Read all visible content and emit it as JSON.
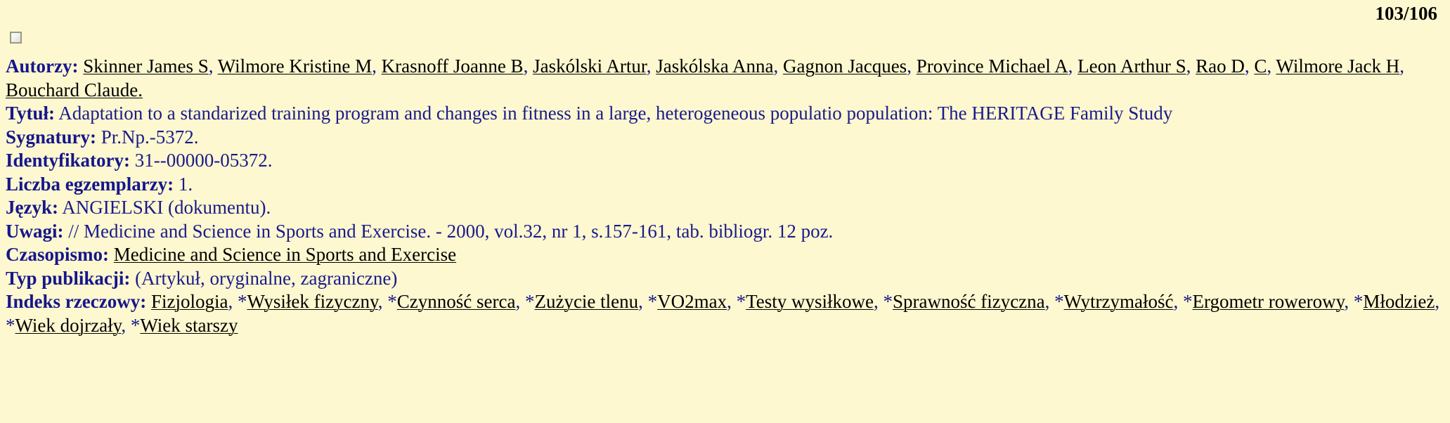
{
  "page": {
    "counter": "103/106",
    "background_color": "#fdf8cf",
    "label_color": "#16168c",
    "link_color": "#000000"
  },
  "controls": {
    "select_checkbox_name": "select-record-checkbox"
  },
  "record": {
    "fields": [
      {
        "key": "autorzy",
        "label": "Autorzy:"
      },
      {
        "key": "tytul",
        "label": "Tytuł:"
      },
      {
        "key": "sygnatury",
        "label": "Sygnatury:"
      },
      {
        "key": "identyfikatory",
        "label": "Identyfikatory:"
      },
      {
        "key": "liczba_egzemplarzy",
        "label": "Liczba egzemplarzy:"
      },
      {
        "key": "jezyk",
        "label": "Język:"
      },
      {
        "key": "uwagi",
        "label": "Uwagi:"
      },
      {
        "key": "czasopismo",
        "label": "Czasopismo:"
      },
      {
        "key": "typ_publikacji",
        "label": "Typ publikacji:"
      },
      {
        "key": "indeks_rzeczowy",
        "label": "Indeks rzeczowy:"
      }
    ],
    "labels": {
      "autorzy": "Autorzy:",
      "tytul": "Tytuł:",
      "sygnatury": "Sygnatury:",
      "identyfikatory": "Identyfikatory:",
      "liczba_egzemplarzy": "Liczba egzemplarzy:",
      "jezyk": "Język:",
      "uwagi": "Uwagi:",
      "czasopismo": "Czasopismo:",
      "typ_publikacji": "Typ publikacji:",
      "indeks_rzeczowy": "Indeks rzeczowy:"
    },
    "authors": [
      "Skinner James S",
      "Wilmore Kristine M",
      "Krasnoff Joanne B",
      "Jaskólski Artur",
      "Jaskólska Anna",
      "Gagnon Jacques",
      "Province Michael A",
      "Leon Arthur S",
      "Rao D",
      "C",
      "Wilmore Jack H",
      "Bouchard Claude."
    ],
    "title": "Adaptation to a standarized training program and changes in fitness in a large, heterogeneous populatio population: The HERITAGE Family Study",
    "sygnatury": "Pr.Np.-5372.",
    "identyfikatory": "31--00000-05372.",
    "liczba_egzemplarzy": "1.",
    "jezyk": "ANGIELSKI (dokumentu).",
    "uwagi": "// Medicine and Science in Sports and Exercise. - 2000, vol.32, nr 1, s.157-161, tab. bibliogr. 12 poz.",
    "czasopismo": "Medicine and Science in Sports and Exercise",
    "typ_publikacji": "(Artykuł, oryginalne, zagraniczne)",
    "indeks_rzeczowy": [
      "Fizjologia",
      "*Wysiłek fizyczny",
      "*Czynność serca",
      "*Zużycie tlenu",
      "*VO2max",
      "*Testy wysiłkowe",
      "*Sprawność fizyczna",
      "*Wytrzymałość",
      "*Ergometr rowerowy",
      "*Młodzież",
      "*Wiek dojrzały",
      "*Wiek starszy"
    ]
  }
}
